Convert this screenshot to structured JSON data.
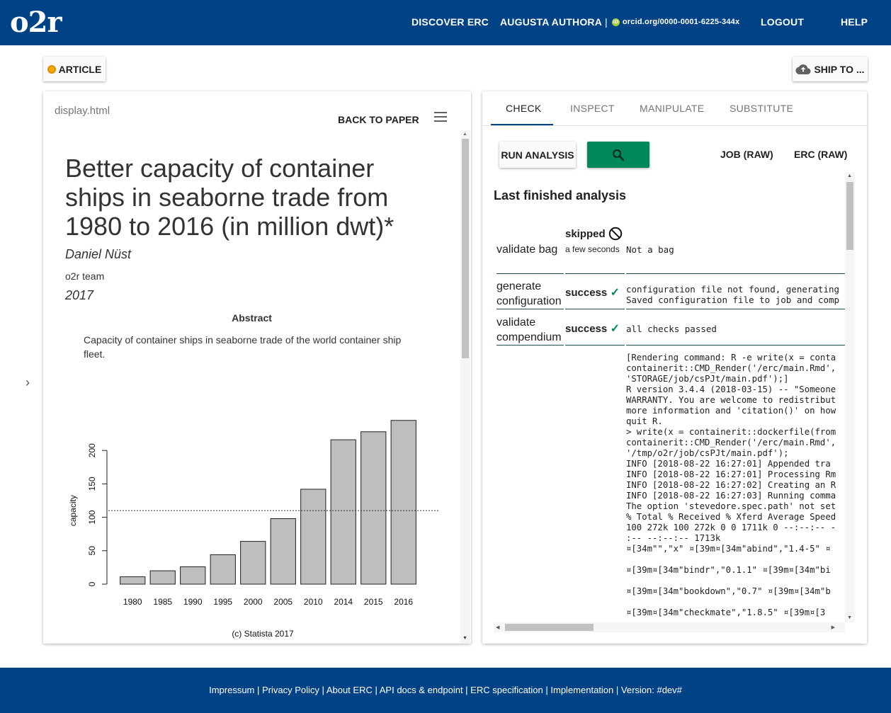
{
  "header": {
    "logo": "o2r",
    "discover": "DISCOVER ERC",
    "user": "AUGUSTA AUTHORA",
    "separator": "|",
    "orcid_icon": "iD",
    "orcid": "orcid.org/0000-0001-6225-344x",
    "logout": "LOGOUT",
    "help": "HELP"
  },
  "toolbar": {
    "article_label": "ARTICLE",
    "ship_label": "SHIP TO ..."
  },
  "left_panel": {
    "filename": "display.html",
    "back_label": "BACK TO PAPER",
    "title": "Better capacity of container ships in seaborne trade from 1980 to 2016 (in million dwt)*",
    "author": "Daniel Nüst",
    "team": "o2r team",
    "year": "2017",
    "abstract_heading": "Abstract",
    "abstract_text": "Capacity of container ships in seaborne trade of the world container ship fleet."
  },
  "chart_data": {
    "type": "bar",
    "categories": [
      "1980",
      "1985",
      "1990",
      "1995",
      "2000",
      "2005",
      "2010",
      "2014",
      "2015",
      "2016"
    ],
    "values": [
      11,
      20,
      26,
      44,
      64,
      98,
      142,
      216,
      228,
      245
    ],
    "ylabel": "capacity",
    "yticks": [
      0,
      50,
      100,
      150,
      200
    ],
    "ylim": [
      0,
      250
    ],
    "reference_line": 110,
    "caption": "(c) Statista 2017",
    "bar_color": "#bebebe"
  },
  "right_panel": {
    "tabs": [
      "CHECK",
      "INSPECT",
      "MANIPULATE",
      "SUBSTITUTE"
    ],
    "active_tab": "CHECK",
    "run_label": "RUN ANALYSIS",
    "job_raw": "JOB (RAW)",
    "erc_raw": "ERC (RAW)",
    "heading": "Last finished analysis",
    "steps": [
      {
        "name": "validate bag",
        "status": "skipped",
        "status_sub": "a few seconds",
        "message": "Not a bag"
      },
      {
        "name": "generate configuration",
        "status": "success",
        "message": "configuration file not found, generating\nSaved configuration file to job and comp"
      },
      {
        "name": "validate compendium",
        "status": "success",
        "message": "all checks passed"
      }
    ],
    "log": "[Rendering command: R -e write(x = conta\ncontainerit::CMD_Render('/erc/main.Rmd',\n'STORAGE/job/csPJt/main.pdf');]\nR version 3.4.4 (2018-03-15) -- \"Someone\nWARRANTY. You are welcome to redistribut\nmore information and 'citation()' on how\nquit R.\n> write(x = containerit::dockerfile(from\ncontainerit::CMD_Render('/erc/main.Rmd',\n'/tmp/o2r/job/csPJt/main.pdf');\nINFO [2018-08-22 16:27:01] Appended tra\nINFO [2018-08-22 16:27:01] Processing Rm\nINFO [2018-08-22 16:27:02] Creating an R\nINFO [2018-08-22 16:27:03] Running comma\nThe option 'stevedore.spec.path' not set\n% Total % Received % Xferd Average Speed\n100 272k 100 272k 0 0 1711k 0 --:--:-- -\n:-- --:--:-- 1713k\n¤[34m\"\",\"x\" ¤[39m¤[34m\"abind\",\"1.4-5\" ¤\n\n¤[39m¤[34m\"bindr\",\"0.1.1\" ¤[39m¤[34m\"bi\n\n¤[39m¤[34m\"bookdown\",\"0.7\" ¤[39m¤[34m\"b\n\n¤[39m¤[34m\"checkmate\",\"1.8.5\" ¤[39m¤[3"
  },
  "footer": {
    "links": [
      "Impressum",
      "Privacy Policy",
      "About ERC",
      "API docs & endpoint",
      "ERC specification",
      "Implementation"
    ],
    "version": "Version: #dev#"
  },
  "colors": {
    "brand": "#004286",
    "success": "#00875a",
    "orcid": "#a6ce39"
  }
}
